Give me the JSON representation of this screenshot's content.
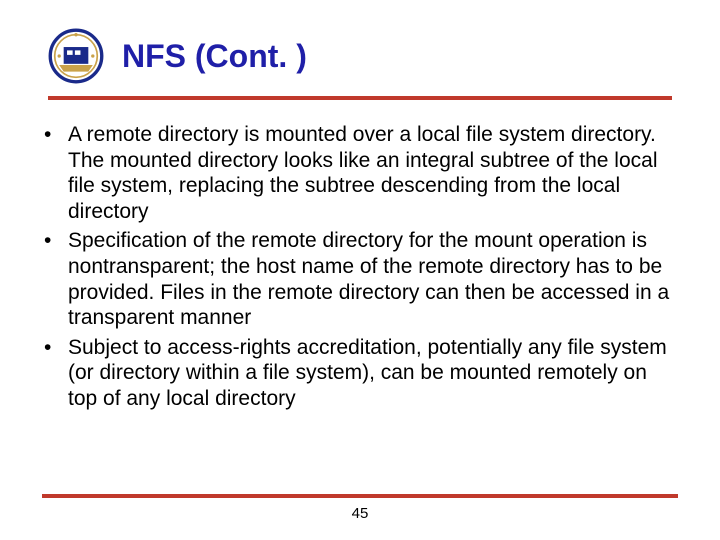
{
  "header": {
    "title": "NFS (Cont. )",
    "logo_alt": "institution-seal"
  },
  "bullets": [
    "A remote directory is mounted over a local file system directory. The mounted directory looks like an integral subtree of the local file system, replacing the subtree descending from the local directory",
    "Specification of the remote directory for the mount operation is nontransparent; the host name of the remote directory has to be provided. Files in the remote directory can then be accessed in a transparent manner",
    "Subject to access-rights accreditation, potentially any file system (or directory within a file system), can be mounted remotely on top of any local directory"
  ],
  "page_number": "45"
}
